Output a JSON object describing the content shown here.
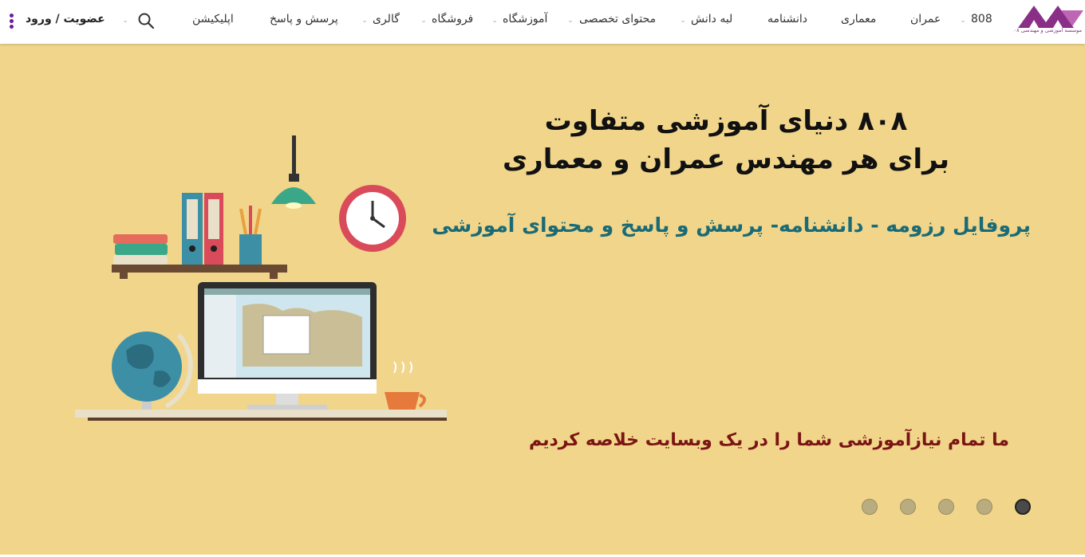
{
  "header": {
    "logo_text": "موسسه آموزشی و مهندسی ۸۰۸ آموزشهای تخصصی عمران و معماری",
    "nav": [
      {
        "label": "808",
        "has_dropdown": true
      },
      {
        "label": "عمران",
        "has_dropdown": false
      },
      {
        "label": "معماری",
        "has_dropdown": false
      },
      {
        "label": "دانشنامه",
        "has_dropdown": false
      },
      {
        "label": "لبه دانش",
        "has_dropdown": true
      },
      {
        "label": "محتوای تخصصی",
        "has_dropdown": true
      },
      {
        "label": "آموزشگاه",
        "has_dropdown": true
      },
      {
        "label": "فروشگاه",
        "has_dropdown": true
      },
      {
        "label": "گالری",
        "has_dropdown": true
      },
      {
        "label": "پرسش و پاسخ",
        "has_dropdown": false
      },
      {
        "label": "اپلیکیشن",
        "has_dropdown": false
      }
    ],
    "search_icon": "search-icon",
    "login_label": "عضویت / ورود",
    "menu_icon": "kebab-menu-icon"
  },
  "hero": {
    "headline_line1": "۸۰۸ دنیای آموزشی متفاوت",
    "headline_line2": "برای هر مهندس عمران و معماری",
    "subline": "پروفایل رزومه - دانشنامه- پرسش و پاسخ و محتوای آموزشی",
    "tagline": "ما تمام نیازآموزشی شما را در یک وبسایت خلاصه کردیم",
    "background_color": "#f0d58b",
    "slides_count": 5,
    "active_slide": 5
  },
  "colors": {
    "brand": "#8a2f87",
    "subline": "#1b6b76",
    "tagline": "#7b1414"
  }
}
